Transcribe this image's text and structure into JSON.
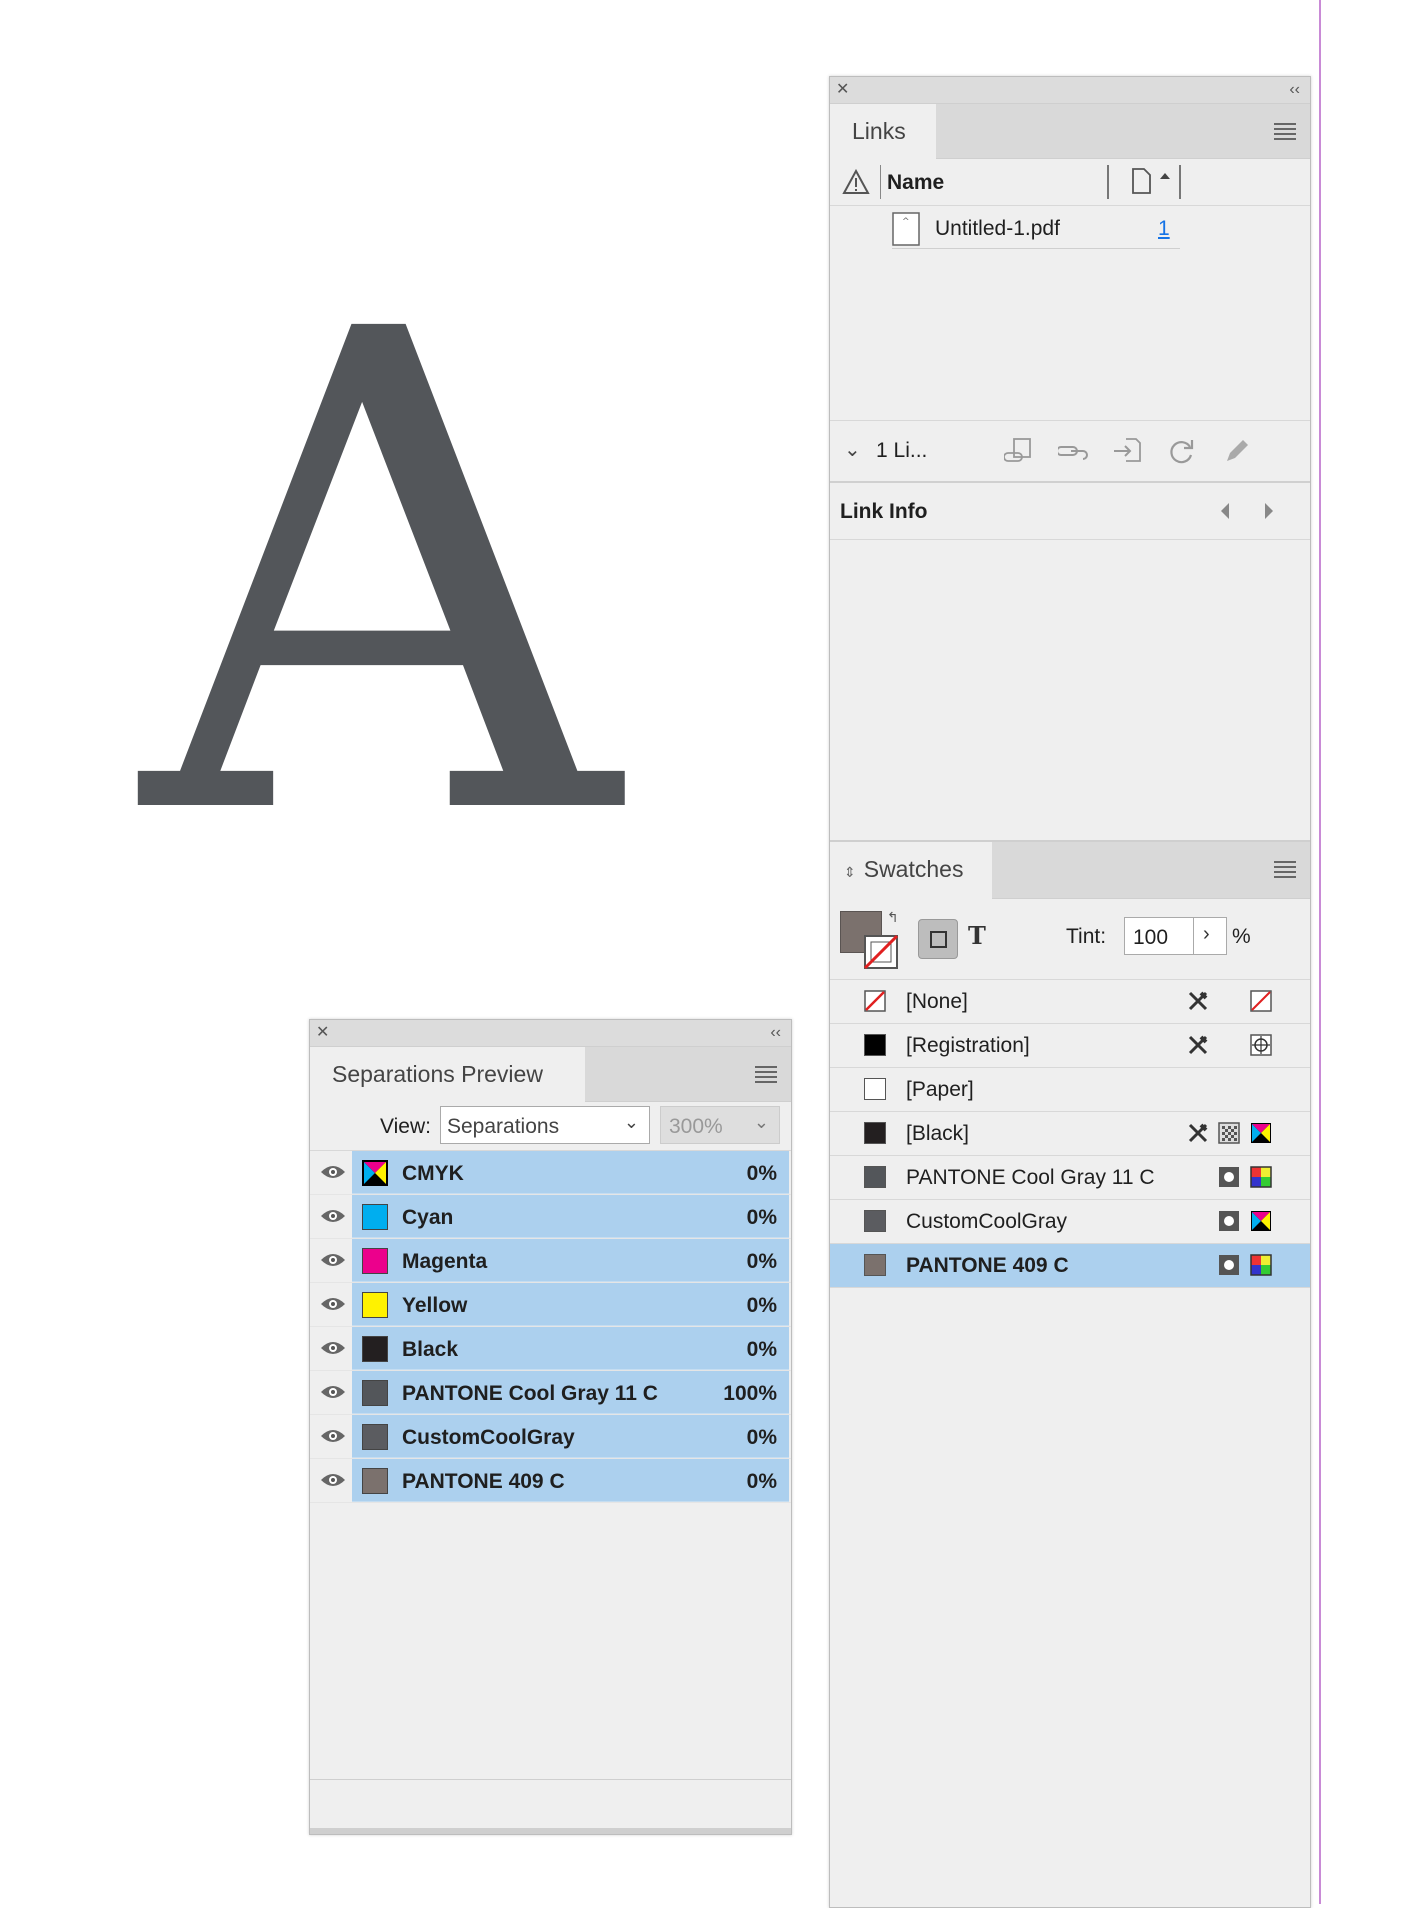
{
  "canvas": {
    "letter": "A"
  },
  "links_panel": {
    "tab_label": "Links",
    "header_name": "Name",
    "row": {
      "filename": "Untitled-1.pdf",
      "page": "1"
    },
    "count_label": "1 Li...",
    "link_info_label": "Link Info"
  },
  "swatches_panel": {
    "tab_label": "Swatches",
    "tint_label": "Tint:",
    "tint_value": "100",
    "tint_unit": "%",
    "text_toggle": "T",
    "items": [
      {
        "name": "[None]",
        "color": "none",
        "selected": false
      },
      {
        "name": "[Registration]",
        "color": "#000000",
        "selected": false
      },
      {
        "name": "[Paper]",
        "color": "#ffffff",
        "selected": false
      },
      {
        "name": "[Black]",
        "color": "#231f20",
        "selected": false
      },
      {
        "name": "PANTONE Cool Gray 11 C",
        "color": "#53565a",
        "selected": false
      },
      {
        "name": "CustomCoolGray",
        "color": "#5b5c60",
        "selected": false
      },
      {
        "name": "PANTONE 409 C",
        "color": "#7b716d",
        "selected": true
      }
    ]
  },
  "separations_panel": {
    "tab_label": "Separations Preview",
    "view_label": "View:",
    "view_value": "Separations",
    "zoom_value": "300%",
    "items": [
      {
        "name": "CMYK",
        "percent": "0%",
        "color": "cmyk"
      },
      {
        "name": "Cyan",
        "percent": "0%",
        "color": "#00aeef"
      },
      {
        "name": "Magenta",
        "percent": "0%",
        "color": "#ec008c"
      },
      {
        "name": "Yellow",
        "percent": "0%",
        "color": "#fff200"
      },
      {
        "name": "Black",
        "percent": "0%",
        "color": "#231f20"
      },
      {
        "name": "PANTONE Cool Gray 11 C",
        "percent": "100%",
        "color": "#53565a"
      },
      {
        "name": "CustomCoolGray",
        "percent": "0%",
        "color": "#5b5c60"
      },
      {
        "name": "PANTONE 409 C",
        "percent": "0%",
        "color": "#7b716d"
      }
    ]
  },
  "colors": {
    "selection": "#acd0ee",
    "letter_fill": "#53565a",
    "guide": "#c98ad6"
  }
}
